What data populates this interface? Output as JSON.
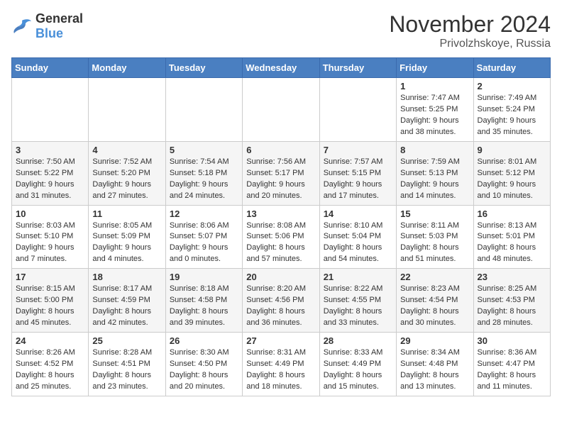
{
  "header": {
    "logo_general": "General",
    "logo_blue": "Blue",
    "month_title": "November 2024",
    "location": "Privolzhskoye, Russia"
  },
  "days_of_week": [
    "Sunday",
    "Monday",
    "Tuesday",
    "Wednesday",
    "Thursday",
    "Friday",
    "Saturday"
  ],
  "weeks": [
    [
      {
        "day": "",
        "sunrise": "",
        "sunset": "",
        "daylight": ""
      },
      {
        "day": "",
        "sunrise": "",
        "sunset": "",
        "daylight": ""
      },
      {
        "day": "",
        "sunrise": "",
        "sunset": "",
        "daylight": ""
      },
      {
        "day": "",
        "sunrise": "",
        "sunset": "",
        "daylight": ""
      },
      {
        "day": "",
        "sunrise": "",
        "sunset": "",
        "daylight": ""
      },
      {
        "day": "1",
        "sunrise": "Sunrise: 7:47 AM",
        "sunset": "Sunset: 5:25 PM",
        "daylight": "Daylight: 9 hours and 38 minutes."
      },
      {
        "day": "2",
        "sunrise": "Sunrise: 7:49 AM",
        "sunset": "Sunset: 5:24 PM",
        "daylight": "Daylight: 9 hours and 35 minutes."
      }
    ],
    [
      {
        "day": "3",
        "sunrise": "Sunrise: 7:50 AM",
        "sunset": "Sunset: 5:22 PM",
        "daylight": "Daylight: 9 hours and 31 minutes."
      },
      {
        "day": "4",
        "sunrise": "Sunrise: 7:52 AM",
        "sunset": "Sunset: 5:20 PM",
        "daylight": "Daylight: 9 hours and 27 minutes."
      },
      {
        "day": "5",
        "sunrise": "Sunrise: 7:54 AM",
        "sunset": "Sunset: 5:18 PM",
        "daylight": "Daylight: 9 hours and 24 minutes."
      },
      {
        "day": "6",
        "sunrise": "Sunrise: 7:56 AM",
        "sunset": "Sunset: 5:17 PM",
        "daylight": "Daylight: 9 hours and 20 minutes."
      },
      {
        "day": "7",
        "sunrise": "Sunrise: 7:57 AM",
        "sunset": "Sunset: 5:15 PM",
        "daylight": "Daylight: 9 hours and 17 minutes."
      },
      {
        "day": "8",
        "sunrise": "Sunrise: 7:59 AM",
        "sunset": "Sunset: 5:13 PM",
        "daylight": "Daylight: 9 hours and 14 minutes."
      },
      {
        "day": "9",
        "sunrise": "Sunrise: 8:01 AM",
        "sunset": "Sunset: 5:12 PM",
        "daylight": "Daylight: 9 hours and 10 minutes."
      }
    ],
    [
      {
        "day": "10",
        "sunrise": "Sunrise: 8:03 AM",
        "sunset": "Sunset: 5:10 PM",
        "daylight": "Daylight: 9 hours and 7 minutes."
      },
      {
        "day": "11",
        "sunrise": "Sunrise: 8:05 AM",
        "sunset": "Sunset: 5:09 PM",
        "daylight": "Daylight: 9 hours and 4 minutes."
      },
      {
        "day": "12",
        "sunrise": "Sunrise: 8:06 AM",
        "sunset": "Sunset: 5:07 PM",
        "daylight": "Daylight: 9 hours and 0 minutes."
      },
      {
        "day": "13",
        "sunrise": "Sunrise: 8:08 AM",
        "sunset": "Sunset: 5:06 PM",
        "daylight": "Daylight: 8 hours and 57 minutes."
      },
      {
        "day": "14",
        "sunrise": "Sunrise: 8:10 AM",
        "sunset": "Sunset: 5:04 PM",
        "daylight": "Daylight: 8 hours and 54 minutes."
      },
      {
        "day": "15",
        "sunrise": "Sunrise: 8:11 AM",
        "sunset": "Sunset: 5:03 PM",
        "daylight": "Daylight: 8 hours and 51 minutes."
      },
      {
        "day": "16",
        "sunrise": "Sunrise: 8:13 AM",
        "sunset": "Sunset: 5:01 PM",
        "daylight": "Daylight: 8 hours and 48 minutes."
      }
    ],
    [
      {
        "day": "17",
        "sunrise": "Sunrise: 8:15 AM",
        "sunset": "Sunset: 5:00 PM",
        "daylight": "Daylight: 8 hours and 45 minutes."
      },
      {
        "day": "18",
        "sunrise": "Sunrise: 8:17 AM",
        "sunset": "Sunset: 4:59 PM",
        "daylight": "Daylight: 8 hours and 42 minutes."
      },
      {
        "day": "19",
        "sunrise": "Sunrise: 8:18 AM",
        "sunset": "Sunset: 4:58 PM",
        "daylight": "Daylight: 8 hours and 39 minutes."
      },
      {
        "day": "20",
        "sunrise": "Sunrise: 8:20 AM",
        "sunset": "Sunset: 4:56 PM",
        "daylight": "Daylight: 8 hours and 36 minutes."
      },
      {
        "day": "21",
        "sunrise": "Sunrise: 8:22 AM",
        "sunset": "Sunset: 4:55 PM",
        "daylight": "Daylight: 8 hours and 33 minutes."
      },
      {
        "day": "22",
        "sunrise": "Sunrise: 8:23 AM",
        "sunset": "Sunset: 4:54 PM",
        "daylight": "Daylight: 8 hours and 30 minutes."
      },
      {
        "day": "23",
        "sunrise": "Sunrise: 8:25 AM",
        "sunset": "Sunset: 4:53 PM",
        "daylight": "Daylight: 8 hours and 28 minutes."
      }
    ],
    [
      {
        "day": "24",
        "sunrise": "Sunrise: 8:26 AM",
        "sunset": "Sunset: 4:52 PM",
        "daylight": "Daylight: 8 hours and 25 minutes."
      },
      {
        "day": "25",
        "sunrise": "Sunrise: 8:28 AM",
        "sunset": "Sunset: 4:51 PM",
        "daylight": "Daylight: 8 hours and 23 minutes."
      },
      {
        "day": "26",
        "sunrise": "Sunrise: 8:30 AM",
        "sunset": "Sunset: 4:50 PM",
        "daylight": "Daylight: 8 hours and 20 minutes."
      },
      {
        "day": "27",
        "sunrise": "Sunrise: 8:31 AM",
        "sunset": "Sunset: 4:49 PM",
        "daylight": "Daylight: 8 hours and 18 minutes."
      },
      {
        "day": "28",
        "sunrise": "Sunrise: 8:33 AM",
        "sunset": "Sunset: 4:49 PM",
        "daylight": "Daylight: 8 hours and 15 minutes."
      },
      {
        "day": "29",
        "sunrise": "Sunrise: 8:34 AM",
        "sunset": "Sunset: 4:48 PM",
        "daylight": "Daylight: 8 hours and 13 minutes."
      },
      {
        "day": "30",
        "sunrise": "Sunrise: 8:36 AM",
        "sunset": "Sunset: 4:47 PM",
        "daylight": "Daylight: 8 hours and 11 minutes."
      }
    ]
  ]
}
